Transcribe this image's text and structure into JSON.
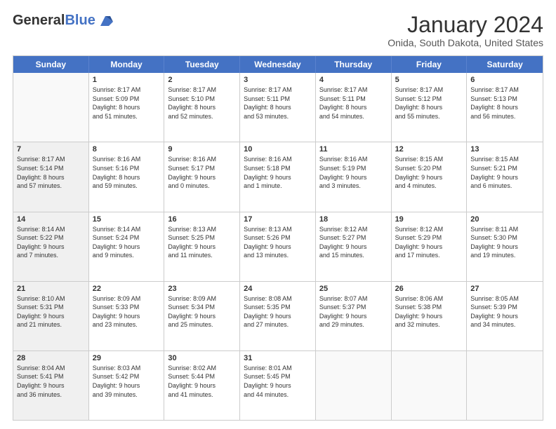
{
  "logo": {
    "text_general": "General",
    "text_blue": "Blue"
  },
  "header": {
    "month": "January 2024",
    "location": "Onida, South Dakota, United States"
  },
  "weekdays": [
    "Sunday",
    "Monday",
    "Tuesday",
    "Wednesday",
    "Thursday",
    "Friday",
    "Saturday"
  ],
  "rows": [
    [
      {
        "day": "",
        "lines": [],
        "empty": true
      },
      {
        "day": "1",
        "lines": [
          "Sunrise: 8:17 AM",
          "Sunset: 5:09 PM",
          "Daylight: 8 hours",
          "and 51 minutes."
        ]
      },
      {
        "day": "2",
        "lines": [
          "Sunrise: 8:17 AM",
          "Sunset: 5:10 PM",
          "Daylight: 8 hours",
          "and 52 minutes."
        ]
      },
      {
        "day": "3",
        "lines": [
          "Sunrise: 8:17 AM",
          "Sunset: 5:11 PM",
          "Daylight: 8 hours",
          "and 53 minutes."
        ]
      },
      {
        "day": "4",
        "lines": [
          "Sunrise: 8:17 AM",
          "Sunset: 5:11 PM",
          "Daylight: 8 hours",
          "and 54 minutes."
        ]
      },
      {
        "day": "5",
        "lines": [
          "Sunrise: 8:17 AM",
          "Sunset: 5:12 PM",
          "Daylight: 8 hours",
          "and 55 minutes."
        ]
      },
      {
        "day": "6",
        "lines": [
          "Sunrise: 8:17 AM",
          "Sunset: 5:13 PM",
          "Daylight: 8 hours",
          "and 56 minutes."
        ]
      }
    ],
    [
      {
        "day": "7",
        "lines": [
          "Sunrise: 8:17 AM",
          "Sunset: 5:14 PM",
          "Daylight: 8 hours",
          "and 57 minutes."
        ],
        "shaded": true
      },
      {
        "day": "8",
        "lines": [
          "Sunrise: 8:16 AM",
          "Sunset: 5:16 PM",
          "Daylight: 8 hours",
          "and 59 minutes."
        ]
      },
      {
        "day": "9",
        "lines": [
          "Sunrise: 8:16 AM",
          "Sunset: 5:17 PM",
          "Daylight: 9 hours",
          "and 0 minutes."
        ]
      },
      {
        "day": "10",
        "lines": [
          "Sunrise: 8:16 AM",
          "Sunset: 5:18 PM",
          "Daylight: 9 hours",
          "and 1 minute."
        ]
      },
      {
        "day": "11",
        "lines": [
          "Sunrise: 8:16 AM",
          "Sunset: 5:19 PM",
          "Daylight: 9 hours",
          "and 3 minutes."
        ]
      },
      {
        "day": "12",
        "lines": [
          "Sunrise: 8:15 AM",
          "Sunset: 5:20 PM",
          "Daylight: 9 hours",
          "and 4 minutes."
        ]
      },
      {
        "day": "13",
        "lines": [
          "Sunrise: 8:15 AM",
          "Sunset: 5:21 PM",
          "Daylight: 9 hours",
          "and 6 minutes."
        ]
      }
    ],
    [
      {
        "day": "14",
        "lines": [
          "Sunrise: 8:14 AM",
          "Sunset: 5:22 PM",
          "Daylight: 9 hours",
          "and 7 minutes."
        ],
        "shaded": true
      },
      {
        "day": "15",
        "lines": [
          "Sunrise: 8:14 AM",
          "Sunset: 5:24 PM",
          "Daylight: 9 hours",
          "and 9 minutes."
        ]
      },
      {
        "day": "16",
        "lines": [
          "Sunrise: 8:13 AM",
          "Sunset: 5:25 PM",
          "Daylight: 9 hours",
          "and 11 minutes."
        ]
      },
      {
        "day": "17",
        "lines": [
          "Sunrise: 8:13 AM",
          "Sunset: 5:26 PM",
          "Daylight: 9 hours",
          "and 13 minutes."
        ]
      },
      {
        "day": "18",
        "lines": [
          "Sunrise: 8:12 AM",
          "Sunset: 5:27 PM",
          "Daylight: 9 hours",
          "and 15 minutes."
        ]
      },
      {
        "day": "19",
        "lines": [
          "Sunrise: 8:12 AM",
          "Sunset: 5:29 PM",
          "Daylight: 9 hours",
          "and 17 minutes."
        ]
      },
      {
        "day": "20",
        "lines": [
          "Sunrise: 8:11 AM",
          "Sunset: 5:30 PM",
          "Daylight: 9 hours",
          "and 19 minutes."
        ]
      }
    ],
    [
      {
        "day": "21",
        "lines": [
          "Sunrise: 8:10 AM",
          "Sunset: 5:31 PM",
          "Daylight: 9 hours",
          "and 21 minutes."
        ],
        "shaded": true
      },
      {
        "day": "22",
        "lines": [
          "Sunrise: 8:09 AM",
          "Sunset: 5:33 PM",
          "Daylight: 9 hours",
          "and 23 minutes."
        ]
      },
      {
        "day": "23",
        "lines": [
          "Sunrise: 8:09 AM",
          "Sunset: 5:34 PM",
          "Daylight: 9 hours",
          "and 25 minutes."
        ]
      },
      {
        "day": "24",
        "lines": [
          "Sunrise: 8:08 AM",
          "Sunset: 5:35 PM",
          "Daylight: 9 hours",
          "and 27 minutes."
        ]
      },
      {
        "day": "25",
        "lines": [
          "Sunrise: 8:07 AM",
          "Sunset: 5:37 PM",
          "Daylight: 9 hours",
          "and 29 minutes."
        ]
      },
      {
        "day": "26",
        "lines": [
          "Sunrise: 8:06 AM",
          "Sunset: 5:38 PM",
          "Daylight: 9 hours",
          "and 32 minutes."
        ]
      },
      {
        "day": "27",
        "lines": [
          "Sunrise: 8:05 AM",
          "Sunset: 5:39 PM",
          "Daylight: 9 hours",
          "and 34 minutes."
        ]
      }
    ],
    [
      {
        "day": "28",
        "lines": [
          "Sunrise: 8:04 AM",
          "Sunset: 5:41 PM",
          "Daylight: 9 hours",
          "and 36 minutes."
        ],
        "shaded": true
      },
      {
        "day": "29",
        "lines": [
          "Sunrise: 8:03 AM",
          "Sunset: 5:42 PM",
          "Daylight: 9 hours",
          "and 39 minutes."
        ]
      },
      {
        "day": "30",
        "lines": [
          "Sunrise: 8:02 AM",
          "Sunset: 5:44 PM",
          "Daylight: 9 hours",
          "and 41 minutes."
        ]
      },
      {
        "day": "31",
        "lines": [
          "Sunrise: 8:01 AM",
          "Sunset: 5:45 PM",
          "Daylight: 9 hours",
          "and 44 minutes."
        ]
      },
      {
        "day": "",
        "lines": [],
        "empty": true
      },
      {
        "day": "",
        "lines": [],
        "empty": true
      },
      {
        "day": "",
        "lines": [],
        "empty": true
      }
    ]
  ]
}
